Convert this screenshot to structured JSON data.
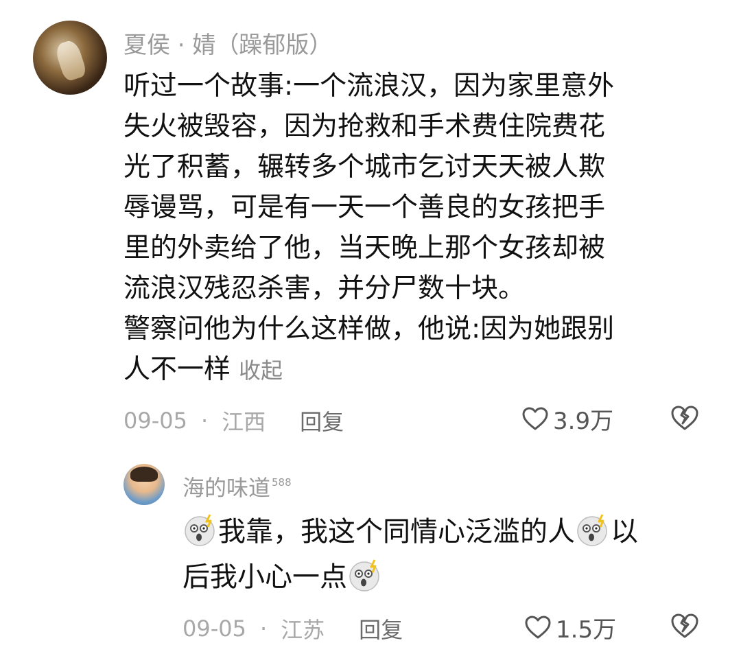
{
  "comment": {
    "username": "夏侯 · 婧（躁郁版）",
    "lines": [
      "听过一个故事:一个流浪汉，因为家里意外",
      "失火被毁容，因为抢救和手术费住院费花",
      "光了积蓄，辗转多个城市乞讨天天被人欺",
      "辱谩骂，可是有一天一个善良的女孩把手",
      "里的外卖给了他，当天晚上那个女孩却被",
      "流浪汉残忍杀害，并分尸数十块。",
      "警察问他为什么这样做，他说:因为她跟别",
      "人不一样"
    ],
    "collapse_label": "收起",
    "date": "09-05",
    "separator": "·",
    "location": "江西",
    "reply_label": "回复",
    "likes": "3.9万",
    "avatar_icon": "avatar-woman-figure"
  },
  "reply": {
    "username": "海的味道",
    "badge": "588",
    "text_part1": "我靠，我这个同情心泛滥的人",
    "text_part2": "以",
    "text_part3": "后我小心一点",
    "emoji_icon": "shocked-face-emoji",
    "date": "09-05",
    "separator": "·",
    "location": "江苏",
    "reply_label": "回复",
    "likes": "1.5万",
    "avatar_icon": "avatar-child"
  },
  "icons": {
    "like": "heart-outline-icon",
    "dislike": "broken-heart-icon"
  }
}
